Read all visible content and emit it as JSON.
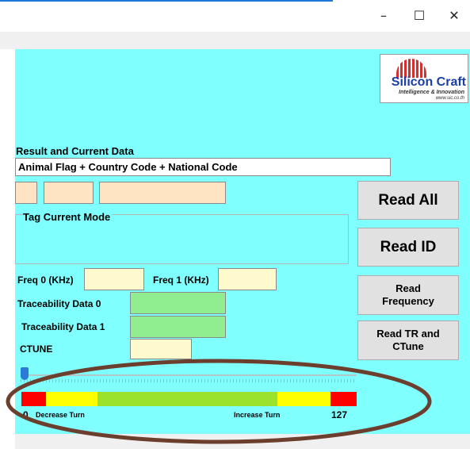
{
  "window": {
    "controls": {
      "minimize": "–",
      "maximize": "☐",
      "close": "✕"
    }
  },
  "logo": {
    "name": "Silicon Craft",
    "tagline": "Intelligence & Innovation",
    "url": "www.sic.co.th"
  },
  "result_section": {
    "title": "Result and Current Data",
    "animal_field": "Animal Flag + Country Code + National Code",
    "code_field_1": "",
    "code_field_2": "",
    "code_field_3": ""
  },
  "tag_mode": {
    "title": "Tag Current Mode"
  },
  "frequency": {
    "freq0_label": "Freq 0 (KHz)",
    "freq0_value": "",
    "freq1_label": "Freq 1 (KHz)",
    "freq1_value": ""
  },
  "traceability": {
    "data0_label": "Traceability Data 0",
    "data0_value": "",
    "data1_label": "Traceability Data 1",
    "data1_value": ""
  },
  "ctune": {
    "label": "CTUNE",
    "value": ""
  },
  "buttons": {
    "read_all": "Read All",
    "read_id": "Read ID",
    "read_frequency_line1": "Read",
    "read_frequency_line2": "Frequency",
    "read_tr_line1": "Read TR and",
    "read_tr_line2": "CTune"
  },
  "turn_slider": {
    "min": 0,
    "max": 127,
    "value": 0,
    "min_label": "0",
    "max_label": "127",
    "decrease_label": "Decrease Turn",
    "increase_label": "Increase Turn"
  },
  "colors": {
    "client_bg": "#80ffff",
    "bar_red": "#ff0000",
    "bar_yellow": "#ffff00",
    "bar_green": "#9be22d",
    "annotation": "#6b3e2e"
  }
}
